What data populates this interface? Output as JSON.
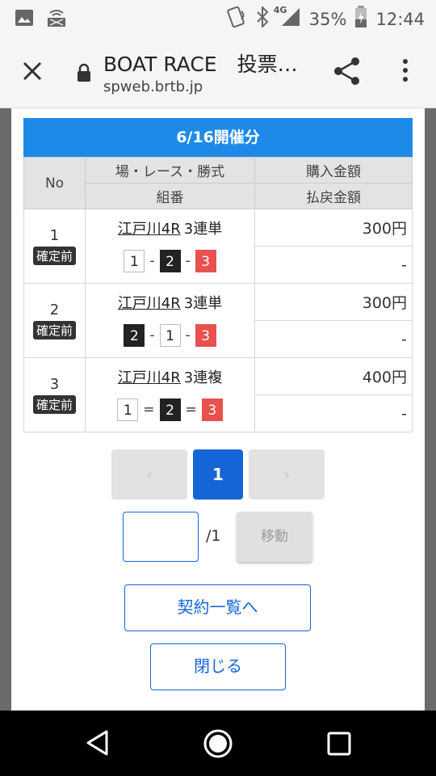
{
  "status_bar": {
    "battery_text": "35%",
    "time": "12:44",
    "network": "4G"
  },
  "tab": {
    "title": "BOAT RACE　投票…",
    "url": "spweb.brtb.jp"
  },
  "date_header": "6/16開催分",
  "table": {
    "headers": {
      "no": "No",
      "race": "場・レース・勝式",
      "combo": "組番",
      "purchase": "購入金額",
      "refund": "払戻金額"
    },
    "rows": [
      {
        "no": "1",
        "status": "確定前",
        "venue_race": "江戸川4R",
        "bet_type": "3連単",
        "boats": [
          "1",
          "2",
          "3"
        ],
        "separator": "-",
        "purchase": "300円",
        "refund": "-"
      },
      {
        "no": "2",
        "status": "確定前",
        "venue_race": "江戸川4R",
        "bet_type": "3連単",
        "boats": [
          "2",
          "1",
          "3"
        ],
        "separator": "-",
        "purchase": "300円",
        "refund": "-"
      },
      {
        "no": "3",
        "status": "確定前",
        "venue_race": "江戸川4R",
        "bet_type": "3連複",
        "boats": [
          "1",
          "2",
          "3"
        ],
        "separator": "=",
        "purchase": "400円",
        "refund": "-"
      }
    ]
  },
  "pagination": {
    "prev": "‹",
    "current": "1",
    "next": "›",
    "total": "/1",
    "move_label": "移動",
    "input_value": ""
  },
  "buttons": {
    "contract_list": "契約一覧へ",
    "close": "閉じる"
  },
  "colors": {
    "header_blue": "#1e8ae8",
    "primary_blue": "#1565d8",
    "boat1": "#ffffff",
    "boat2": "#222222",
    "boat3": "#e8514d"
  }
}
